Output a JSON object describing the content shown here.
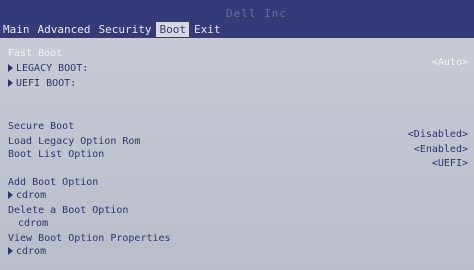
{
  "header": {
    "brand": "Dell Inc",
    "tabs": [
      {
        "label": "Main"
      },
      {
        "label": "Advanced"
      },
      {
        "label": "Security"
      },
      {
        "label": "Boot"
      },
      {
        "label": "Exit"
      }
    ],
    "active_tab": "Boot"
  },
  "boot": {
    "fast_boot": {
      "label": "Fast Boot",
      "value": "<Auto>"
    },
    "legacy_boot": {
      "label": "LEGACY BOOT:"
    },
    "uefi_boot": {
      "label": "UEFI BOOT:"
    },
    "secure_boot": {
      "label": "Secure Boot",
      "value": "<Disabled>"
    },
    "load_legacy": {
      "label": "Load Legacy Option Rom",
      "value": "<Enabled>"
    },
    "boot_list": {
      "label": "Boot List Option",
      "value": "<UEFI>"
    },
    "add_boot": {
      "label": "Add Boot Option",
      "item": "cdrom"
    },
    "delete_boot": {
      "label": "Delete a Boot Option",
      "item": "cdrom"
    },
    "view_boot": {
      "label": "View Boot Option Properties",
      "item": "cdrom"
    }
  },
  "colors": {
    "header_bg": "#353a78",
    "panel_bg": "#bfc3cd",
    "text_blue": "#2c3470",
    "text_white": "#f2f3f8"
  }
}
